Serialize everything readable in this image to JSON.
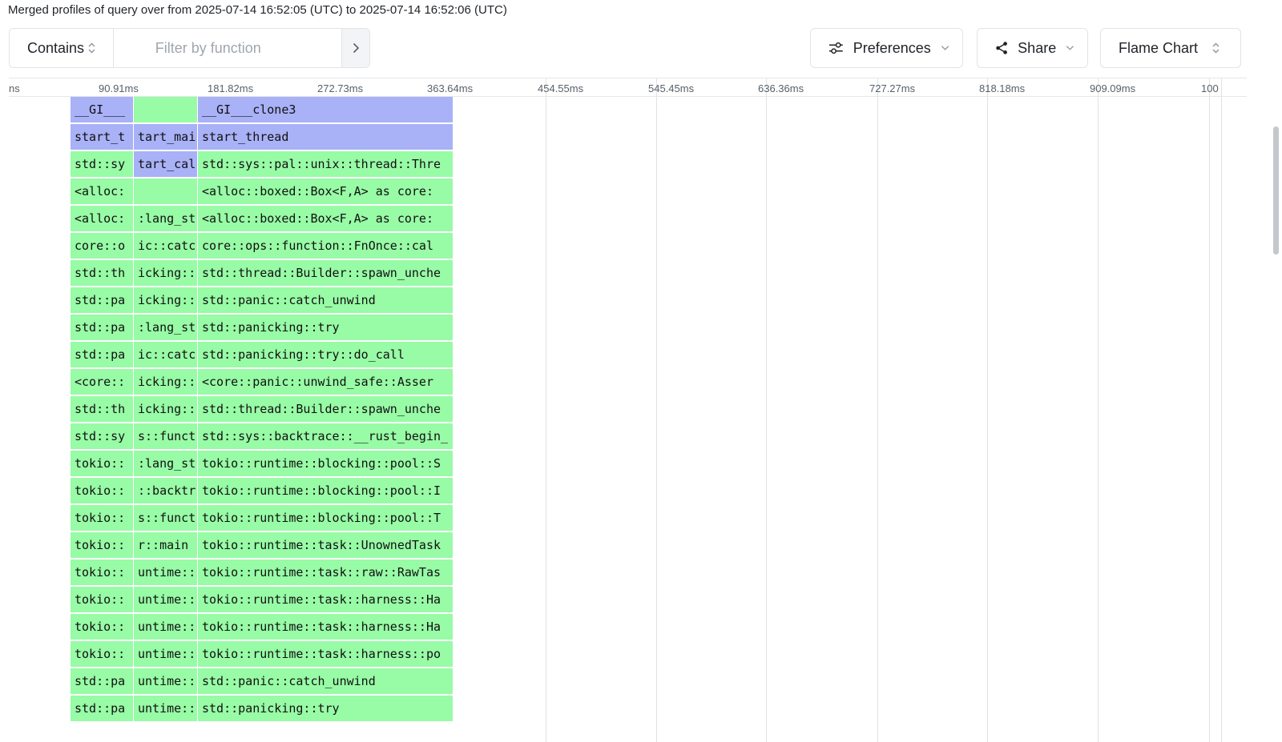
{
  "page": {
    "title": "Merged profiles of query over from 2025-07-14 16:52:05 (UTC) to 2025-07-14 16:52:06 (UTC)"
  },
  "toolbar": {
    "contains_label": "Contains",
    "filter_placeholder": "Filter by function",
    "preferences_label": "Preferences",
    "share_label": "Share",
    "view_mode_label": "Flame Chart"
  },
  "icons": {
    "contains": "updown-chevron-icon",
    "submit": "chevron-right-icon",
    "preferences": "sliders-icon",
    "share": "share-icon",
    "dropdown": "chevron-down-icon",
    "view_mode": "updown-chevron-icon"
  },
  "colors": {
    "frame_blue": "#a9b1f7",
    "frame_green": "#98fba6"
  },
  "axis": {
    "ticks": [
      "ns",
      "90.91ms",
      "181.82ms",
      "272.73ms",
      "363.64ms",
      "454.55ms",
      "545.45ms",
      "636.36ms",
      "727.27ms",
      "818.18ms",
      "909.09ms",
      "100"
    ]
  },
  "flame": {
    "rows": [
      [
        "__GI___",
        "",
        "__GI___clone3"
      ],
      [
        "start_t",
        "tart_mai",
        "start_thread"
      ],
      [
        "std::sy",
        "tart_cal",
        "std::sys::pal::unix::thread::Thre"
      ],
      [
        "<alloc:",
        "",
        "<alloc::boxed::Box<F,A> as core:"
      ],
      [
        "<alloc:",
        ":lang_st",
        "<alloc::boxed::Box<F,A> as core:"
      ],
      [
        "core::o",
        "ic::catc",
        "core::ops::function::FnOnce::cal"
      ],
      [
        "std::th",
        "icking::",
        "std::thread::Builder::spawn_unche"
      ],
      [
        "std::pa",
        "icking::",
        "std::panic::catch_unwind"
      ],
      [
        "std::pa",
        ":lang_st",
        "std::panicking::try"
      ],
      [
        "std::pa",
        "ic::catc",
        "std::panicking::try::do_call"
      ],
      [
        "<core::",
        "icking::",
        "<core::panic::unwind_safe::Asser"
      ],
      [
        "std::th",
        "icking::",
        "std::thread::Builder::spawn_unche"
      ],
      [
        "std::sy",
        "s::funct",
        "std::sys::backtrace::__rust_begin_"
      ],
      [
        "tokio::",
        ":lang_st",
        "tokio::runtime::blocking::pool::S"
      ],
      [
        "tokio::",
        "::backtr",
        "tokio::runtime::blocking::pool::I"
      ],
      [
        "tokio::",
        "s::funct",
        "tokio::runtime::blocking::pool::T"
      ],
      [
        "tokio::",
        "r::main",
        "tokio::runtime::task::UnownedTask"
      ],
      [
        "tokio::",
        "untime::",
        "tokio::runtime::task::raw::RawTas"
      ],
      [
        "tokio::",
        "untime::",
        "tokio::runtime::task::harness::Ha"
      ],
      [
        "tokio::",
        "untime::",
        "tokio::runtime::task::harness::Ha"
      ],
      [
        "tokio::",
        "untime::",
        "tokio::runtime::task::harness::po"
      ],
      [
        "std::pa",
        "untime::",
        "std::panic::catch_unwind"
      ],
      [
        "std::pa",
        "untime::",
        "std::panicking::try"
      ]
    ]
  }
}
